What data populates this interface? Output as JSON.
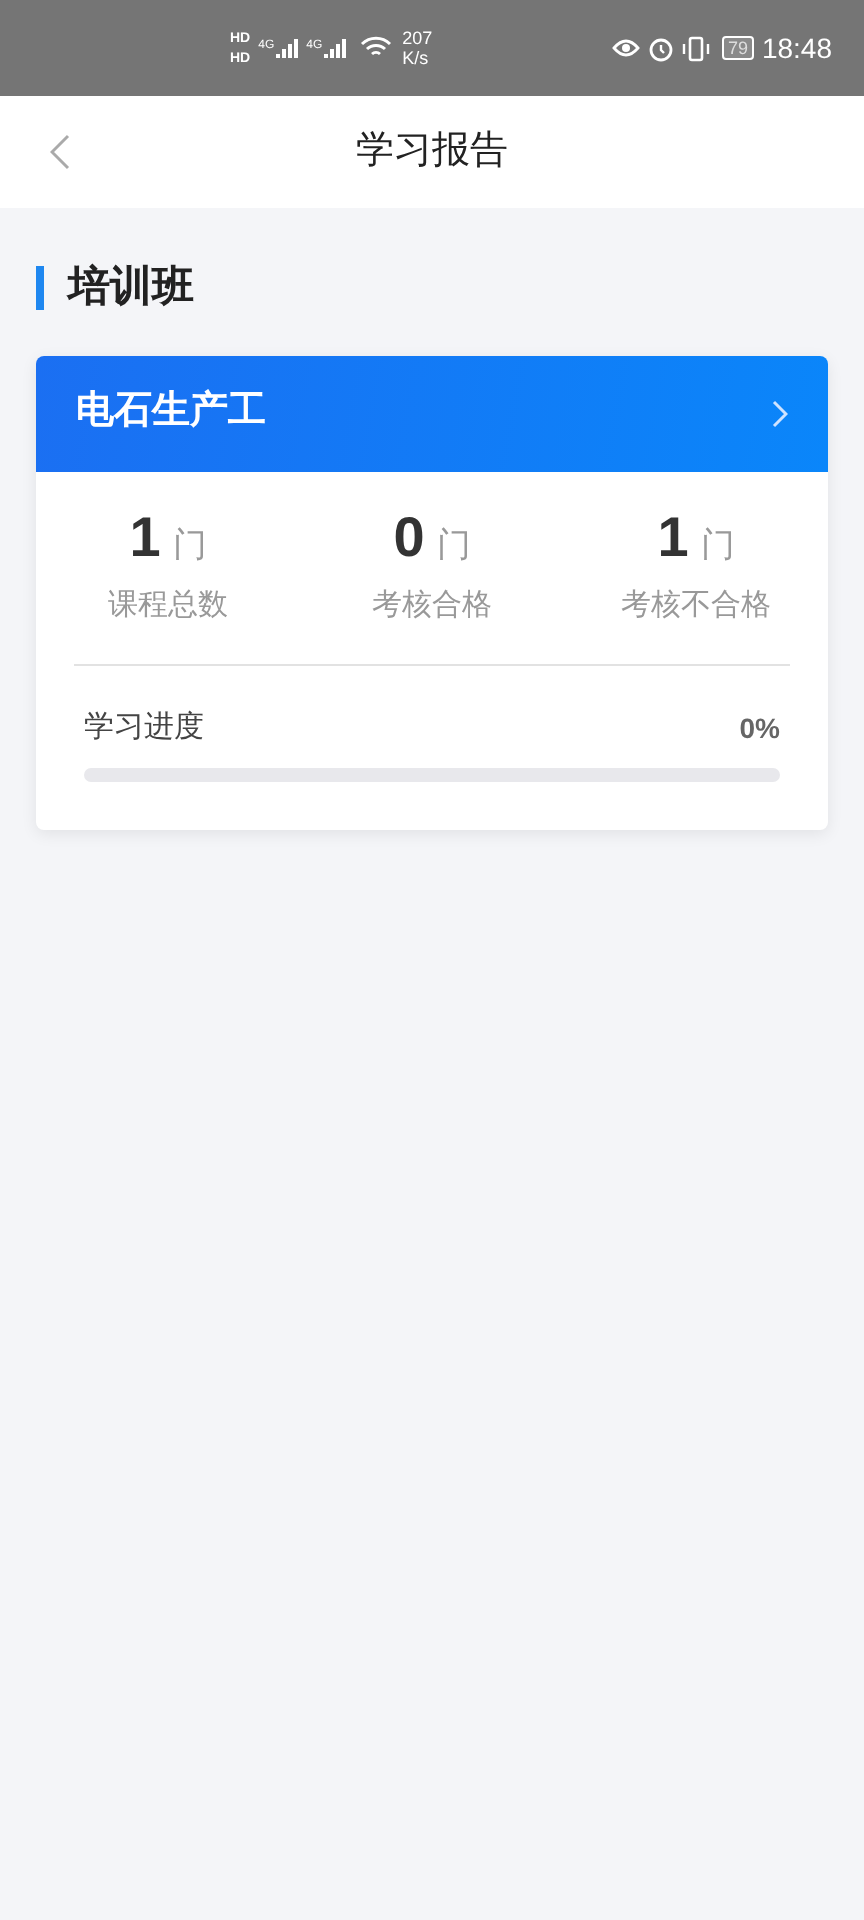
{
  "status_bar": {
    "sim_labels": [
      "HD",
      "HD"
    ],
    "network_labels": [
      "4G",
      "4G"
    ],
    "speed_value": "207",
    "speed_unit": "K/s",
    "battery": "79",
    "time": "18:48"
  },
  "header": {
    "title": "学习报告"
  },
  "section": {
    "title": "培训班"
  },
  "card": {
    "title": "电石生产工",
    "stats": [
      {
        "value": "1",
        "unit": "门",
        "label": "课程总数"
      },
      {
        "value": "0",
        "unit": "门",
        "label": "考核合格"
      },
      {
        "value": "1",
        "unit": "门",
        "label": "考核不合格"
      }
    ],
    "progress": {
      "label": "学习进度",
      "reading": "0%",
      "level": 0
    }
  }
}
